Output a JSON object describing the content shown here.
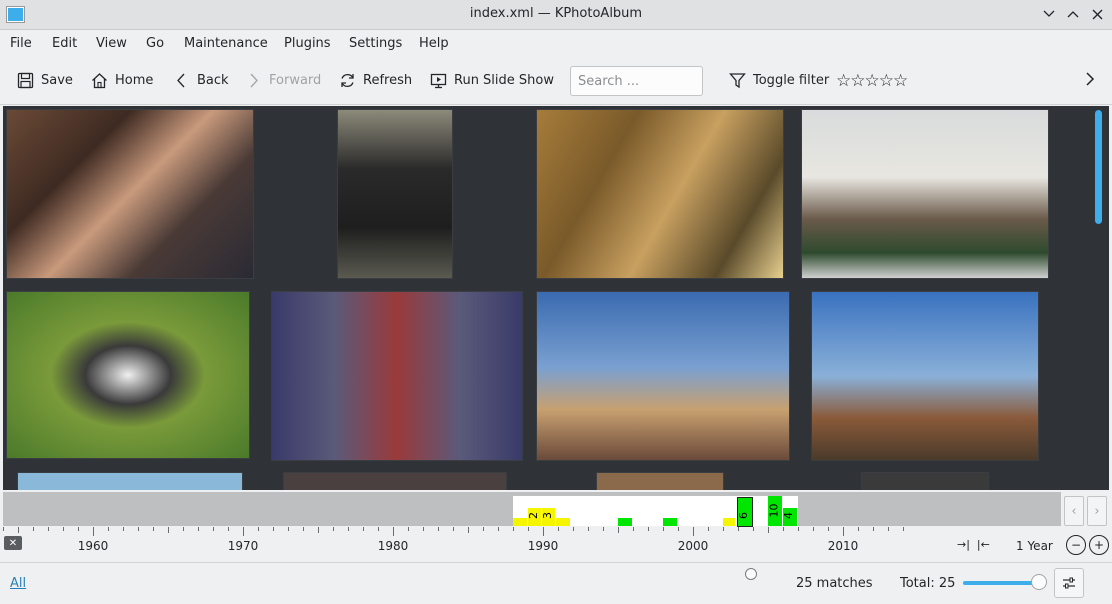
{
  "window": {
    "title": "index.xml — KPhotoAlbum"
  },
  "menu": [
    "File",
    "Edit",
    "View",
    "Go",
    "Maintenance",
    "Plugins",
    "Settings",
    "Help"
  ],
  "toolbar": {
    "save": "Save",
    "home": "Home",
    "back": "Back",
    "forward": "Forward",
    "refresh": "Refresh",
    "slideshow": "Run Slide Show",
    "search_placeholder": "Search ...",
    "toggle_filter": "Toggle filter",
    "rating_stars": "☆☆☆☆☆"
  },
  "timeline": {
    "years": [
      "1960",
      "1970",
      "1980",
      "1990",
      "2000",
      "2010"
    ],
    "bar_labels": [
      "2",
      "3",
      "6",
      "10",
      "4"
    ],
    "scale_label": "1 Year"
  },
  "status": {
    "all_link": "All",
    "matches": "25 matches",
    "total": "Total: 25",
    "thumbnail_size": 0.95
  },
  "colors": {
    "accent": "#3daee9",
    "bar_yellow": "#f5f500",
    "bar_green": "#00e600",
    "viewer_bg": "#2f3236"
  }
}
